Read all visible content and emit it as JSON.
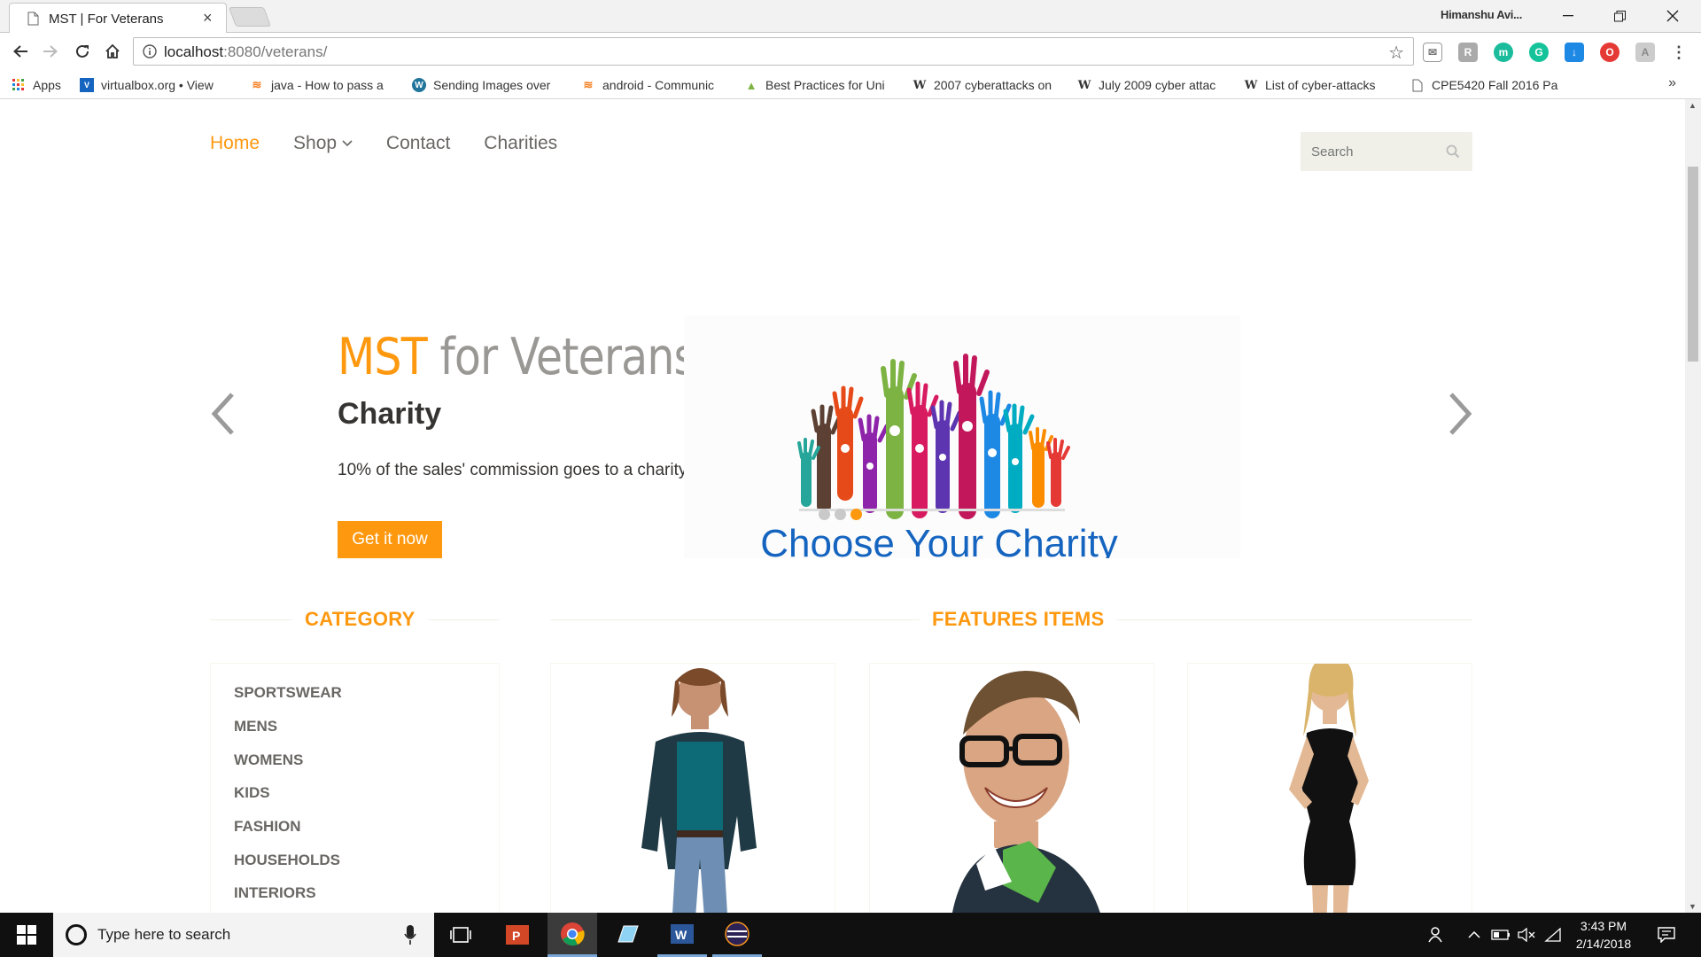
{
  "browser": {
    "tab_title": "MST | For Veterans",
    "tab_close": "×",
    "profile_name": "Himanshu Avi...",
    "url_host": "localhost",
    "url_path": ":8080/veterans/",
    "star": "☆",
    "bookmarks": [
      {
        "label": "Apps",
        "icon": "apps-grid-icon"
      },
      {
        "label": "virtualbox.org • View",
        "icon": "virtualbox-icon"
      },
      {
        "label": "java - How to pass a",
        "icon": "stackoverflow-icon"
      },
      {
        "label": "Sending Images over",
        "icon": "wordpress-icon"
      },
      {
        "label": "android - Communic",
        "icon": "stackoverflow-icon"
      },
      {
        "label": "Best Practices for Uni",
        "icon": "android-icon"
      },
      {
        "label": "2007 cyberattacks on",
        "icon": "wikipedia-icon"
      },
      {
        "label": "July 2009 cyber attac",
        "icon": "wikipedia-icon"
      },
      {
        "label": "List of cyber-attacks",
        "icon": "wikipedia-icon"
      },
      {
        "label": "CPE5420 Fall 2016 Pa",
        "icon": "document-icon"
      }
    ],
    "bookmarks_more": "»"
  },
  "site": {
    "nav": [
      {
        "label": "Home",
        "active": true
      },
      {
        "label": "Shop"
      },
      {
        "label": "Contact"
      },
      {
        "label": "Charities"
      }
    ],
    "search_placeholder": "Search",
    "slider": {
      "title_accent": "MST",
      "title_rest": " for Veterans",
      "subtitle": "Charity",
      "description": "10% of the sales' commission goes to a charity",
      "button": "Get it now",
      "image_caption": "Choose Your Charity",
      "dots": 3,
      "active_dot": 3
    },
    "category_heading": "CATEGORY",
    "features_heading": "FEATURES ITEMS",
    "categories": [
      "SPORTSWEAR",
      "MENS",
      "WOMENS",
      "KIDS",
      "FASHION",
      "HOUSEHOLDS",
      "INTERIORS"
    ]
  },
  "taskbar": {
    "search_placeholder": "Type here to search",
    "time": "3:43 PM",
    "date": "2/14/2018"
  },
  "colors": {
    "accent": "#FE980F",
    "nav_text": "#696763",
    "taskbar": "#101010"
  }
}
